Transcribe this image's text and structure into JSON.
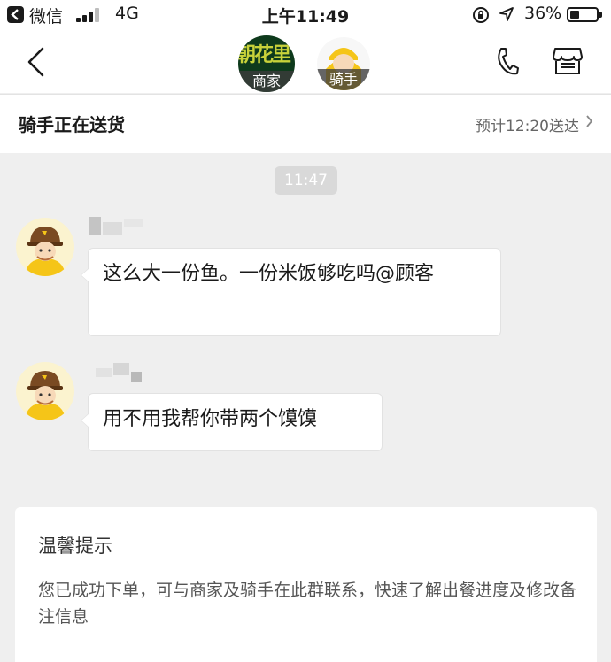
{
  "status_bar": {
    "app_back": "微信",
    "network": "4G",
    "time": "上午11:49",
    "battery_pct": "36%",
    "battery_level": 0.36,
    "signal_bars": 3
  },
  "header": {
    "merchant_logo_text": "朝花里",
    "merchant_badge": "商家",
    "rider_badge": "骑手"
  },
  "delivery": {
    "status": "骑手正在送货",
    "eta": "预计12:20送达"
  },
  "chat": {
    "timestamp": "11:47",
    "messages": [
      {
        "sender": "rider",
        "text": "这么大一份鱼。一份米饭够吃吗@顾客"
      },
      {
        "sender": "rider",
        "text": "用不用我帮你带两个馍馍"
      }
    ]
  },
  "tip": {
    "title": "温馨提示",
    "body": "您已成功下单，可与商家及骑手在此群联系，快速了解出餐进度及修改备注信息"
  },
  "colors": {
    "background": "#efefef",
    "rider_helmet": "#7a4a22",
    "rider_shirt": "#f5c518",
    "merchant_bg": "#0e3a1c"
  }
}
